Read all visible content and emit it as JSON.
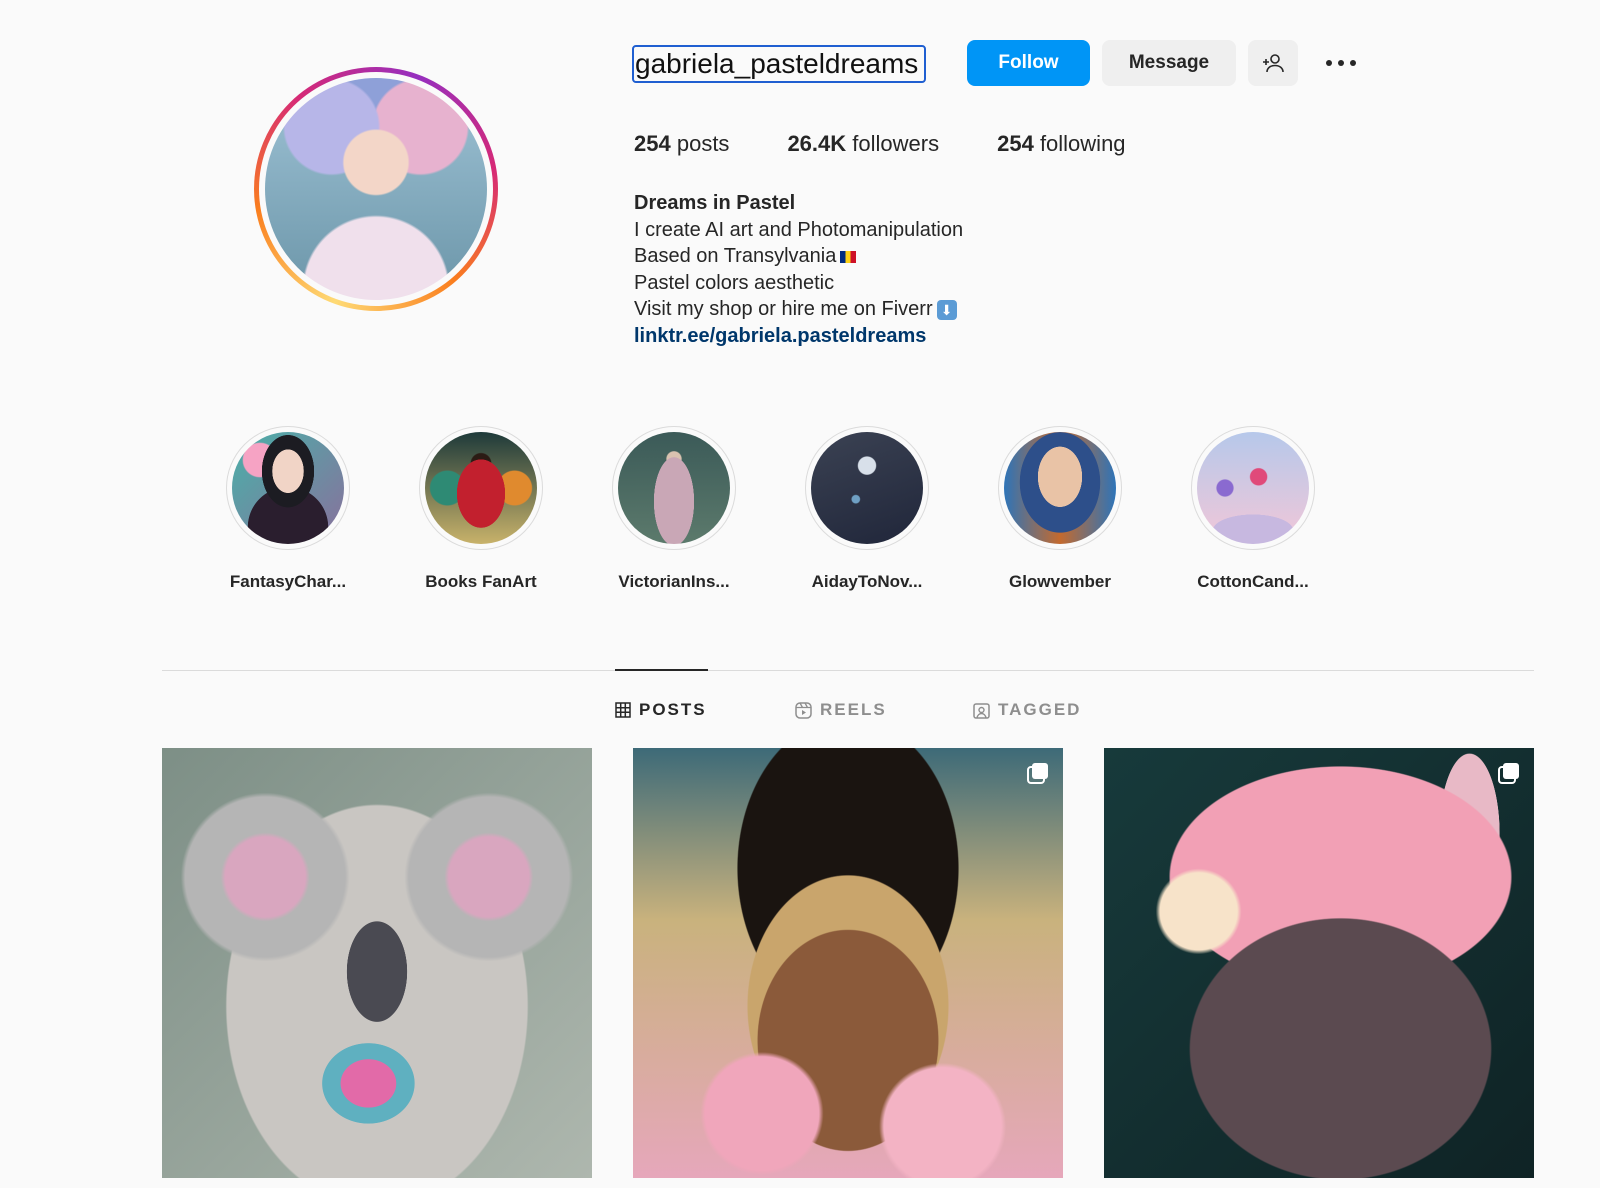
{
  "profile": {
    "username": "gabriela_pasteldreams",
    "follow_label": "Follow",
    "message_label": "Message",
    "add_user_icon": "add-user-icon",
    "more_icon": "more-options-icon",
    "stats": {
      "posts_count": "254",
      "posts_label": "posts",
      "followers_count": "26.4K",
      "followers_label": "followers",
      "following_count": "254",
      "following_label": "following"
    },
    "bio": {
      "name": "Dreams in Pastel",
      "line1": "I create AI art and Photomanipulation",
      "line2": "Based on Transylvania",
      "line3": "Pastel colors aesthetic",
      "line4": "Visit my shop or hire me on Fiverr",
      "link": "linktr.ee/gabriela.pasteldreams"
    }
  },
  "highlights": [
    {
      "label": "FantasyChar..."
    },
    {
      "label": "Books FanArt"
    },
    {
      "label": "VictorianIns..."
    },
    {
      "label": "AidayToNov..."
    },
    {
      "label": "Glowvember"
    },
    {
      "label": "CottonCand..."
    }
  ],
  "tabs": [
    {
      "label": "POSTS",
      "icon": "grid-icon",
      "active": true
    },
    {
      "label": "REELS",
      "icon": "reels-icon",
      "active": false
    },
    {
      "label": "TAGGED",
      "icon": "tagged-icon",
      "active": false
    }
  ],
  "colors": {
    "accent": "#0095f6",
    "link": "#00376b",
    "background": "#fafafa"
  }
}
